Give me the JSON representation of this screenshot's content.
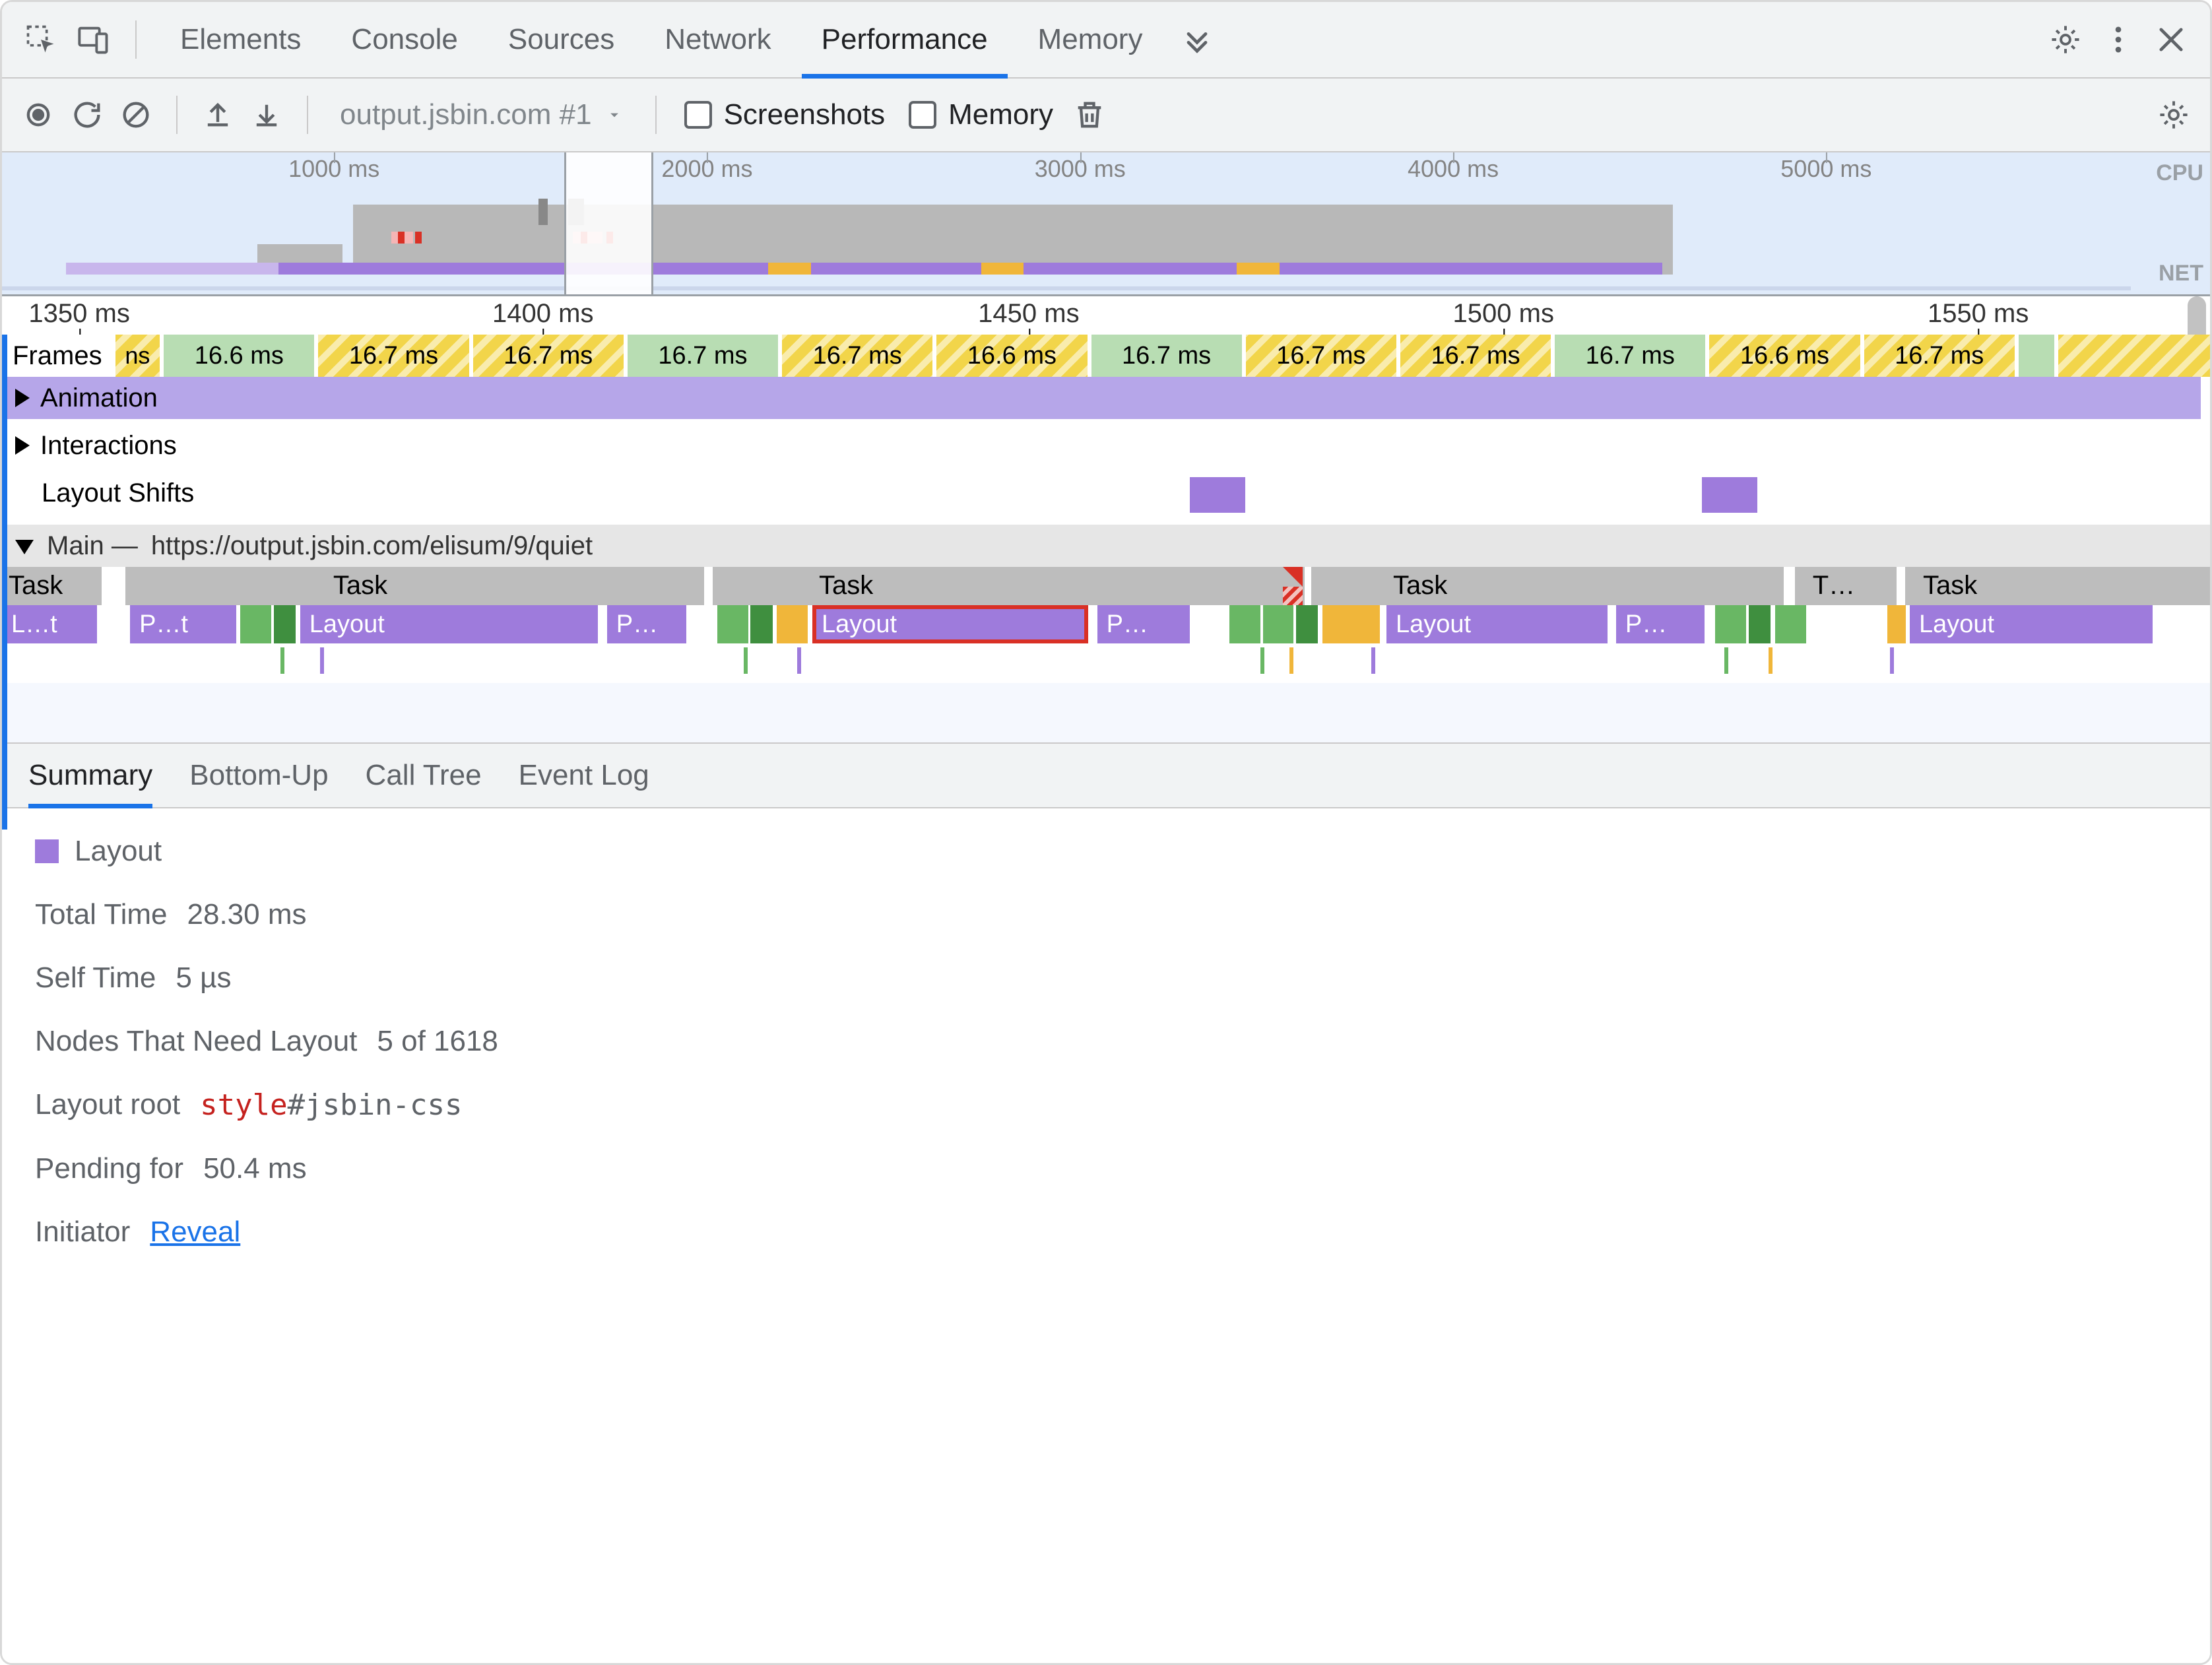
{
  "tabs": {
    "items": [
      "Elements",
      "Console",
      "Sources",
      "Network",
      "Performance",
      "Memory"
    ],
    "active_index": 4
  },
  "toolbar": {
    "recording_label": "output.jsbin.com #1",
    "screenshots_label": "Screenshots",
    "memory_label": "Memory"
  },
  "overview": {
    "ticks": [
      {
        "pos": 16.2,
        "label": "1000 ms"
      },
      {
        "pos": 34.4,
        "label": "2000 ms"
      },
      {
        "pos": 52.6,
        "label": "3000 ms"
      },
      {
        "pos": 70.8,
        "label": "4000 ms"
      },
      {
        "pos": 89.0,
        "label": "5000 ms"
      }
    ],
    "gutter": {
      "cpu": "CPU",
      "net": "NET"
    },
    "brush": {
      "left_pct": 26.4,
      "width_pct": 4.2
    }
  },
  "detail_ruler": {
    "ticks": [
      {
        "pos": 3.5,
        "label": "1350 ms"
      },
      {
        "pos": 24.5,
        "label": "1400 ms"
      },
      {
        "pos": 46.5,
        "label": "1450 ms"
      },
      {
        "pos": 68.0,
        "label": "1500 ms"
      },
      {
        "pos": 89.5,
        "label": "1550 ms"
      }
    ]
  },
  "lanes": {
    "frames_label": "Frames",
    "frames": [
      {
        "w": 2.2,
        "cls": "yellow narrow",
        "label": "ns"
      },
      {
        "w": 7.0,
        "cls": "green",
        "label": "16.6 ms"
      },
      {
        "w": 7.0,
        "cls": "yellow",
        "label": "16.7 ms"
      },
      {
        "w": 7.0,
        "cls": "yellow",
        "label": "16.7 ms"
      },
      {
        "w": 7.0,
        "cls": "green",
        "label": "16.7 ms"
      },
      {
        "w": 7.0,
        "cls": "yellow",
        "label": "16.7 ms"
      },
      {
        "w": 7.0,
        "cls": "yellow",
        "label": "16.6 ms"
      },
      {
        "w": 7.0,
        "cls": "green",
        "label": "16.7 ms"
      },
      {
        "w": 7.0,
        "cls": "yellow",
        "label": "16.7 ms"
      },
      {
        "w": 7.0,
        "cls": "yellow",
        "label": "16.7 ms"
      },
      {
        "w": 7.0,
        "cls": "green",
        "label": "16.7 ms"
      },
      {
        "w": 7.0,
        "cls": "yellow",
        "label": "16.6 ms"
      },
      {
        "w": 7.0,
        "cls": "yellow",
        "label": "16.7 ms"
      },
      {
        "w": 1.8,
        "cls": "green narrow",
        "label": ""
      }
    ],
    "animation_label": "Animation",
    "interactions_label": "Interactions",
    "layout_shifts_label": "Layout Shifts",
    "layout_shifts": [
      {
        "left": 53.8,
        "w": 2.5
      },
      {
        "left": 77.0,
        "w": 2.5
      }
    ],
    "main_prefix": "Main —",
    "main_url": "https://output.jsbin.com/elisum/9/quiet",
    "tasks": [
      {
        "left": 0,
        "w": 4.5,
        "label": "Task",
        "label_left": 0.3
      },
      {
        "left": 5.6,
        "w": 26.2,
        "label": "Task",
        "label_left": 15.0
      },
      {
        "left": 32.2,
        "w": 26.8,
        "label": "Task",
        "label_left": 37.0
      },
      {
        "left": 59.3,
        "w": 21.4,
        "label": "Task",
        "label_left": 63.0,
        "long_task_at": 58.0
      },
      {
        "left": 81.2,
        "w": 4.6,
        "label": "T…",
        "label_left": 82.0
      },
      {
        "left": 86.2,
        "w": 13.8,
        "label": "Task",
        "label_left": 87.0
      }
    ],
    "flame": [
      {
        "left": 0.0,
        "w": 4.3,
        "cls": "purple",
        "label": "L…t"
      },
      {
        "left": 5.8,
        "w": 4.8,
        "cls": "purple",
        "label": "P…t"
      },
      {
        "left": 10.8,
        "w": 1.4,
        "cls": "green",
        "label": ""
      },
      {
        "left": 12.3,
        "w": 1.0,
        "cls": "dkgreen",
        "label": ""
      },
      {
        "left": 13.5,
        "w": 13.5,
        "cls": "purple",
        "label": "Layout"
      },
      {
        "left": 27.4,
        "w": 3.6,
        "cls": "purple",
        "label": "P…"
      },
      {
        "left": 32.4,
        "w": 1.4,
        "cls": "green",
        "label": ""
      },
      {
        "left": 33.9,
        "w": 1.0,
        "cls": "dkgreen",
        "label": ""
      },
      {
        "left": 35.1,
        "w": 1.4,
        "cls": "orange",
        "label": ""
      },
      {
        "left": 36.7,
        "w": 12.5,
        "cls": "purple sel",
        "label": "Layout"
      },
      {
        "left": 49.6,
        "w": 4.2,
        "cls": "purple",
        "label": "P…"
      },
      {
        "left": 55.6,
        "w": 1.4,
        "cls": "green",
        "label": ""
      },
      {
        "left": 57.1,
        "w": 1.4,
        "cls": "green",
        "label": ""
      },
      {
        "left": 58.6,
        "w": 1.0,
        "cls": "dkgreen",
        "label": ""
      },
      {
        "left": 59.8,
        "w": 2.6,
        "cls": "orange",
        "label": ""
      },
      {
        "left": 62.7,
        "w": 10.0,
        "cls": "purple",
        "label": "Layout"
      },
      {
        "left": 73.1,
        "w": 4.0,
        "cls": "purple",
        "label": "P…"
      },
      {
        "left": 77.6,
        "w": 1.4,
        "cls": "green",
        "label": ""
      },
      {
        "left": 79.1,
        "w": 1.0,
        "cls": "dkgreen",
        "label": ""
      },
      {
        "left": 80.3,
        "w": 1.4,
        "cls": "green",
        "label": ""
      },
      {
        "left": 85.4,
        "w": 0.7,
        "cls": "orange",
        "label": ""
      },
      {
        "left": 86.4,
        "w": 11.0,
        "cls": "purple",
        "label": "Layout"
      }
    ],
    "vticks": [
      {
        "left": 12.6,
        "cls": "green"
      },
      {
        "left": 14.4,
        "cls": "purple"
      },
      {
        "left": 33.6,
        "cls": "green"
      },
      {
        "left": 36.0,
        "cls": "purple"
      },
      {
        "left": 57.0,
        "cls": "green"
      },
      {
        "left": 58.3,
        "cls": "orange"
      },
      {
        "left": 62.0,
        "cls": "purple"
      },
      {
        "left": 78.0,
        "cls": "green"
      },
      {
        "left": 80.0,
        "cls": "orange"
      },
      {
        "left": 85.5,
        "cls": "purple"
      }
    ]
  },
  "bottom_tabs": {
    "items": [
      "Summary",
      "Bottom-Up",
      "Call Tree",
      "Event Log"
    ],
    "active_index": 0
  },
  "summary": {
    "event_name": "Layout",
    "rows": {
      "total_time": {
        "k": "Total Time",
        "v": "28.30 ms"
      },
      "self_time": {
        "k": "Self Time",
        "v": "5 µs"
      },
      "nodes": {
        "k": "Nodes That Need Layout",
        "v": "5 of 1618"
      },
      "layout_root": {
        "k": "Layout root",
        "tag": "style",
        "sel": "#jsbin-css"
      },
      "pending_for": {
        "k": "Pending for",
        "v": "50.4 ms"
      },
      "initiator": {
        "k": "Initiator",
        "link": "Reveal"
      }
    }
  }
}
